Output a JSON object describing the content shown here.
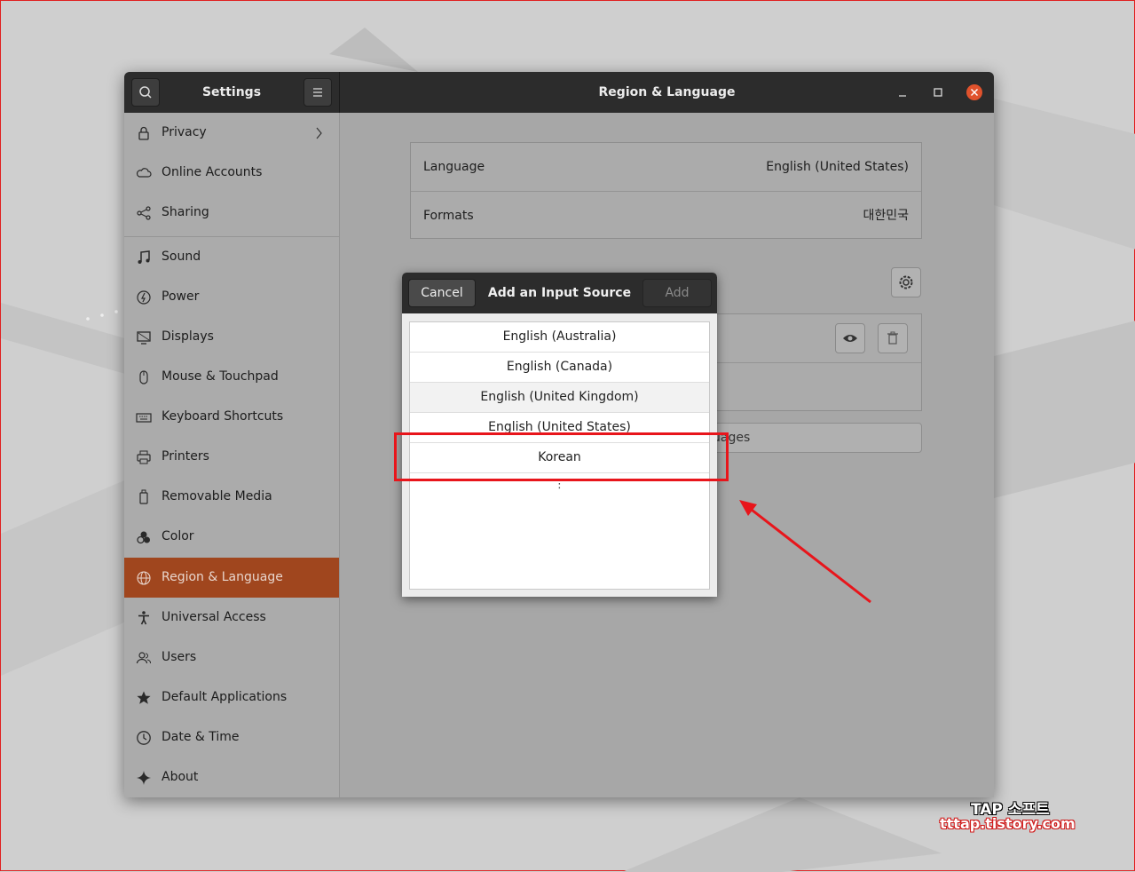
{
  "titlebar": {
    "sidebar_title": "Settings",
    "main_title": "Region & Language",
    "icons": [
      "search-icon",
      "hamburger-menu-icon",
      "minimize-icon",
      "maximize-icon",
      "close-icon"
    ]
  },
  "sidebar": {
    "items": [
      {
        "label": "Privacy",
        "icon": "lock-icon"
      },
      {
        "label": "Online Accounts",
        "icon": "cloud-icon"
      },
      {
        "label": "Sharing",
        "icon": "share-icon"
      },
      {
        "label": "Sound",
        "icon": "music-note-icon"
      },
      {
        "label": "Power",
        "icon": "power-icon"
      },
      {
        "label": "Displays",
        "icon": "display-icon"
      },
      {
        "label": "Mouse & Touchpad",
        "icon": "mouse-icon"
      },
      {
        "label": "Keyboard Shortcuts",
        "icon": "keyboard-icon"
      },
      {
        "label": "Printers",
        "icon": "printer-icon"
      },
      {
        "label": "Removable Media",
        "icon": "usb-drive-icon"
      },
      {
        "label": "Color",
        "icon": "color-icon"
      },
      {
        "label": "Region & Language",
        "icon": "globe-icon",
        "active": true
      },
      {
        "label": "Universal Access",
        "icon": "accessibility-icon"
      },
      {
        "label": "Users",
        "icon": "users-icon"
      },
      {
        "label": "Default Applications",
        "icon": "star-icon"
      },
      {
        "label": "Date & Time",
        "icon": "clock-icon"
      },
      {
        "label": "About",
        "icon": "sparkle-icon"
      }
    ]
  },
  "main": {
    "language_label": "Language",
    "language_value": "English (United States)",
    "formats_label": "Formats",
    "formats_value": "대한민국",
    "manage_partial": "uages"
  },
  "dialog": {
    "title": "Add an Input Source",
    "cancel_label": "Cancel",
    "add_label": "Add",
    "options": [
      "English (Australia)",
      "English (Canada)",
      "English (United Kingdom)",
      "English (United States)",
      "Korean"
    ],
    "more_glyph": "⋮"
  },
  "watermark": {
    "line1": "TAP 소프트",
    "line2": "tttap.tistory.com"
  },
  "colors": {
    "accent": "#a0461e",
    "annotation": "#e8151b",
    "headerbar": "#2c2c2c"
  }
}
